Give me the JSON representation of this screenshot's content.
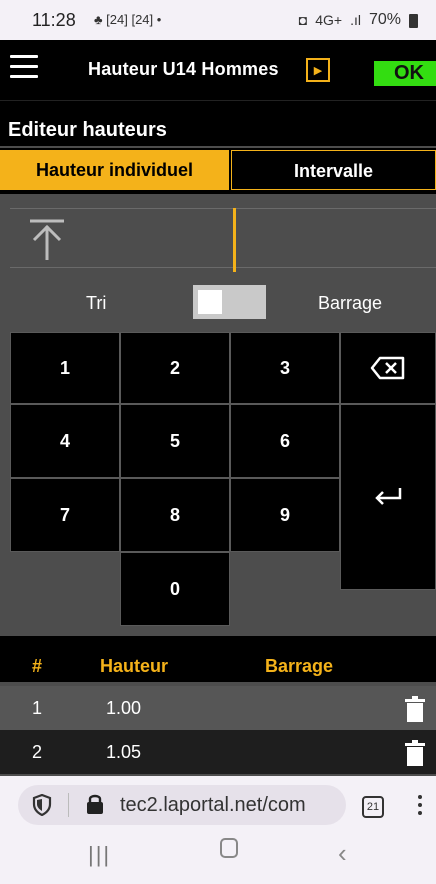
{
  "status_bar": {
    "time": "11:28",
    "notif_icons": "[24] [24] •",
    "network": "4G+",
    "battery": "70%"
  },
  "app": {
    "title": "Hauteur  U14 Hommes",
    "ok_label": "OK",
    "editor_title": "Editeur hauteurs",
    "tabs": {
      "individual": "Hauteur individuel",
      "interval": "Intervalle"
    },
    "toggle": {
      "left": "Tri",
      "right": "Barrage"
    },
    "keypad": {
      "keys": [
        "1",
        "2",
        "3",
        "4",
        "5",
        "6",
        "7",
        "8",
        "9",
        "0"
      ]
    },
    "table": {
      "headers": [
        "#",
        "Hauteur",
        "Barrage"
      ],
      "rows": [
        {
          "num": "1",
          "hauteur": "1.00"
        },
        {
          "num": "2",
          "hauteur": "1.05"
        }
      ]
    }
  },
  "browser": {
    "url": "tec2.laportal.net/com",
    "tab_count": "21"
  },
  "colors": {
    "accent": "#f4b21a",
    "ok_green": "#33dd11",
    "app_bg": "#4d4d4d",
    "black": "#000000"
  },
  "icons": [
    "menu-icon",
    "play-icon",
    "upload-icon",
    "backspace-icon",
    "enter-icon",
    "trash-icon",
    "shield-icon",
    "lock-icon",
    "more-icon"
  ]
}
